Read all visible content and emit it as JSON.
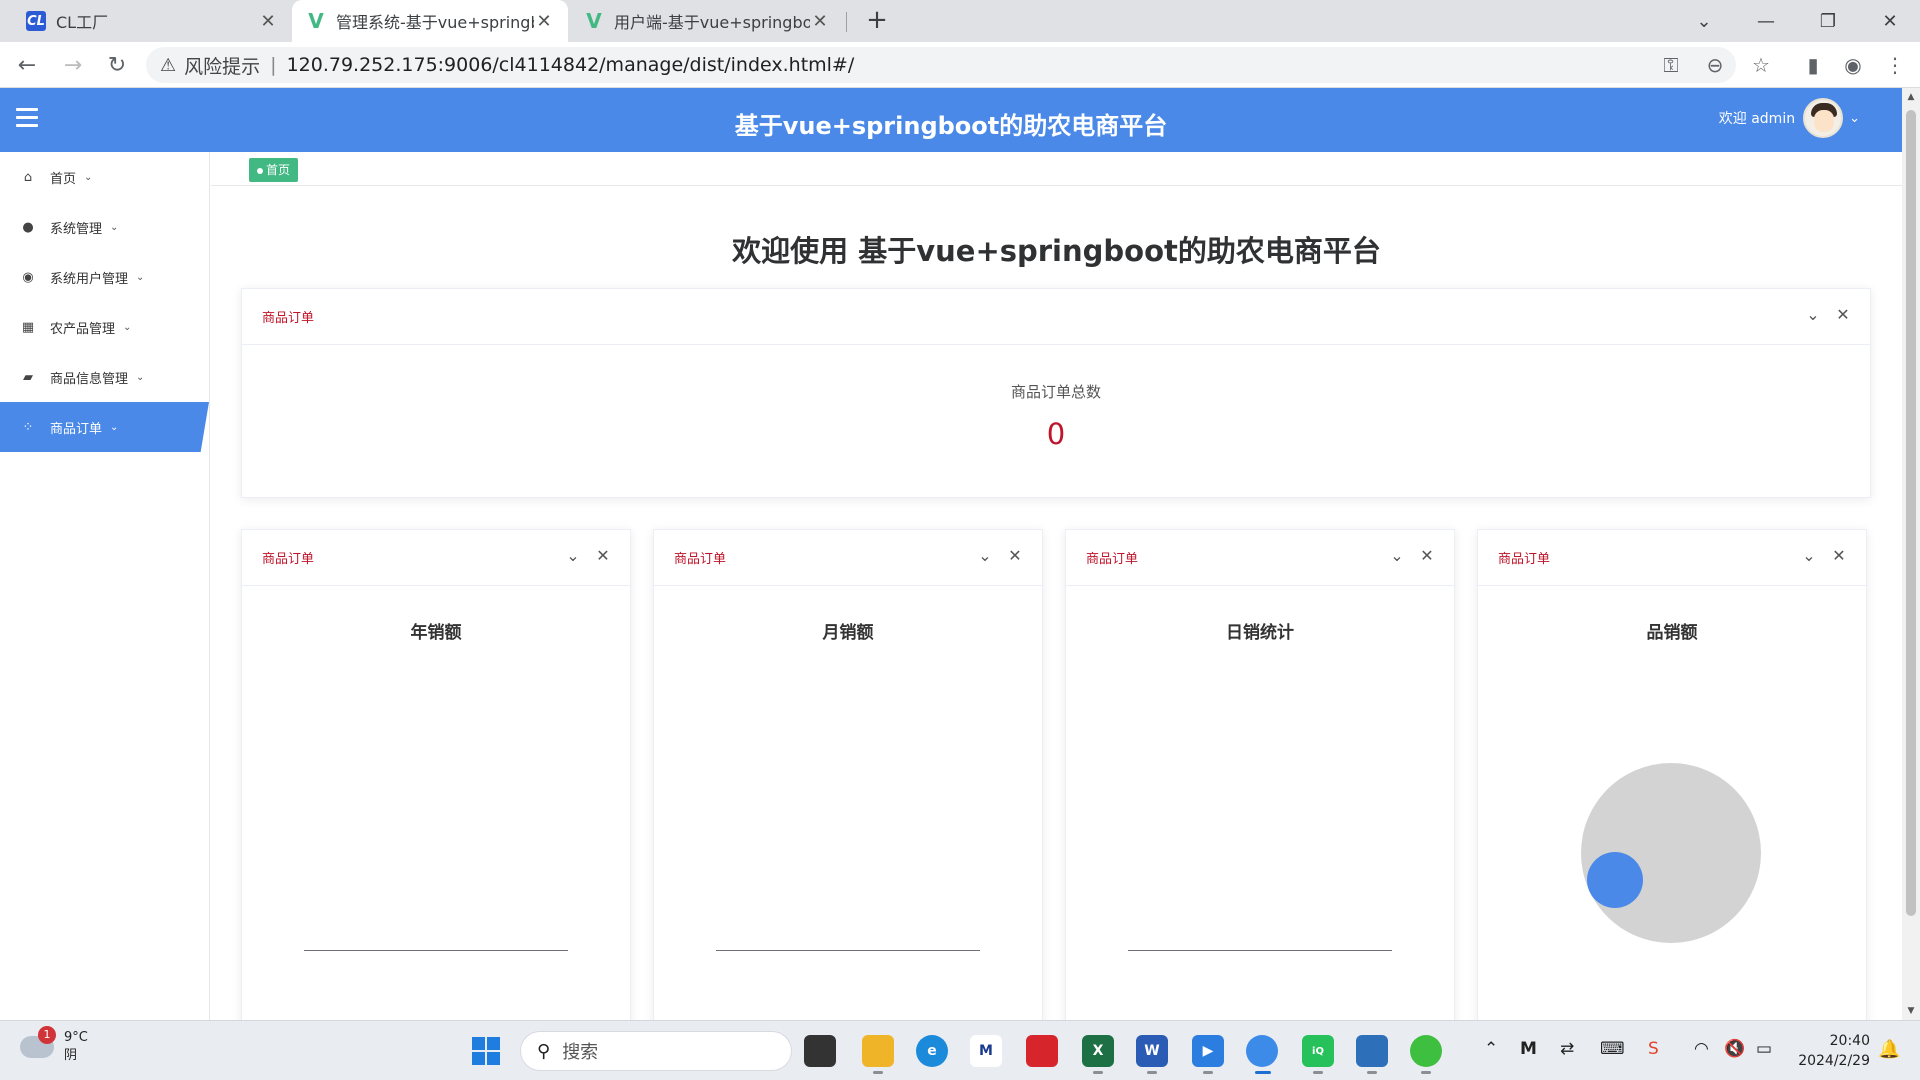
{
  "browser": {
    "tabs": [
      {
        "title": "CL工厂",
        "favicon": "CL",
        "active": false
      },
      {
        "title": "管理系统-基于vue+springbo",
        "favicon": "V",
        "active": true
      },
      {
        "title": "用户端-基于vue+springboot",
        "favicon": "V",
        "active": false
      }
    ],
    "address": {
      "warning_label": "风险提示",
      "separator": "|",
      "url": "120.79.252.175:9006/cl4114842/manage/dist/index.html#/"
    }
  },
  "header": {
    "title": "基于vue+springboot的助农电商平台",
    "user_greeting": "欢迎 admin"
  },
  "sidebar": {
    "items": [
      {
        "label": "首页",
        "icon": "home-icon",
        "active": false
      },
      {
        "label": "系统管理",
        "icon": "circle-icon",
        "active": false
      },
      {
        "label": "系统用户管理",
        "icon": "compass-icon",
        "active": false
      },
      {
        "label": "农产品管理",
        "icon": "grid-icon",
        "active": false
      },
      {
        "label": "商品信息管理",
        "icon": "folder-icon",
        "active": false
      },
      {
        "label": "商品订单",
        "icon": "apps-icon",
        "active": true
      }
    ]
  },
  "tags": [
    {
      "label": "首页"
    }
  ],
  "main": {
    "welcome": "欢迎使用 基于vue+springboot的助农电商平台",
    "summary_card": {
      "header": "商品订单",
      "label": "商品订单总数",
      "value": "0"
    },
    "chart_cards": [
      {
        "header": "商品订单",
        "title": "年销额",
        "kind": "line"
      },
      {
        "header": "商品订单",
        "title": "月销额",
        "kind": "line"
      },
      {
        "header": "商品订单",
        "title": "日销统计",
        "kind": "line"
      },
      {
        "header": "商品订单",
        "title": "品销额",
        "kind": "pie"
      }
    ]
  },
  "taskbar": {
    "weather_temp": "9°C",
    "weather_desc": "阴",
    "weather_badge": "1",
    "search_placeholder": "搜索",
    "time": "20:40",
    "date": "2024/2/29"
  },
  "colors": {
    "accent": "#4a89e8",
    "tag": "#42b983",
    "card_header_text": "#c0142a"
  }
}
